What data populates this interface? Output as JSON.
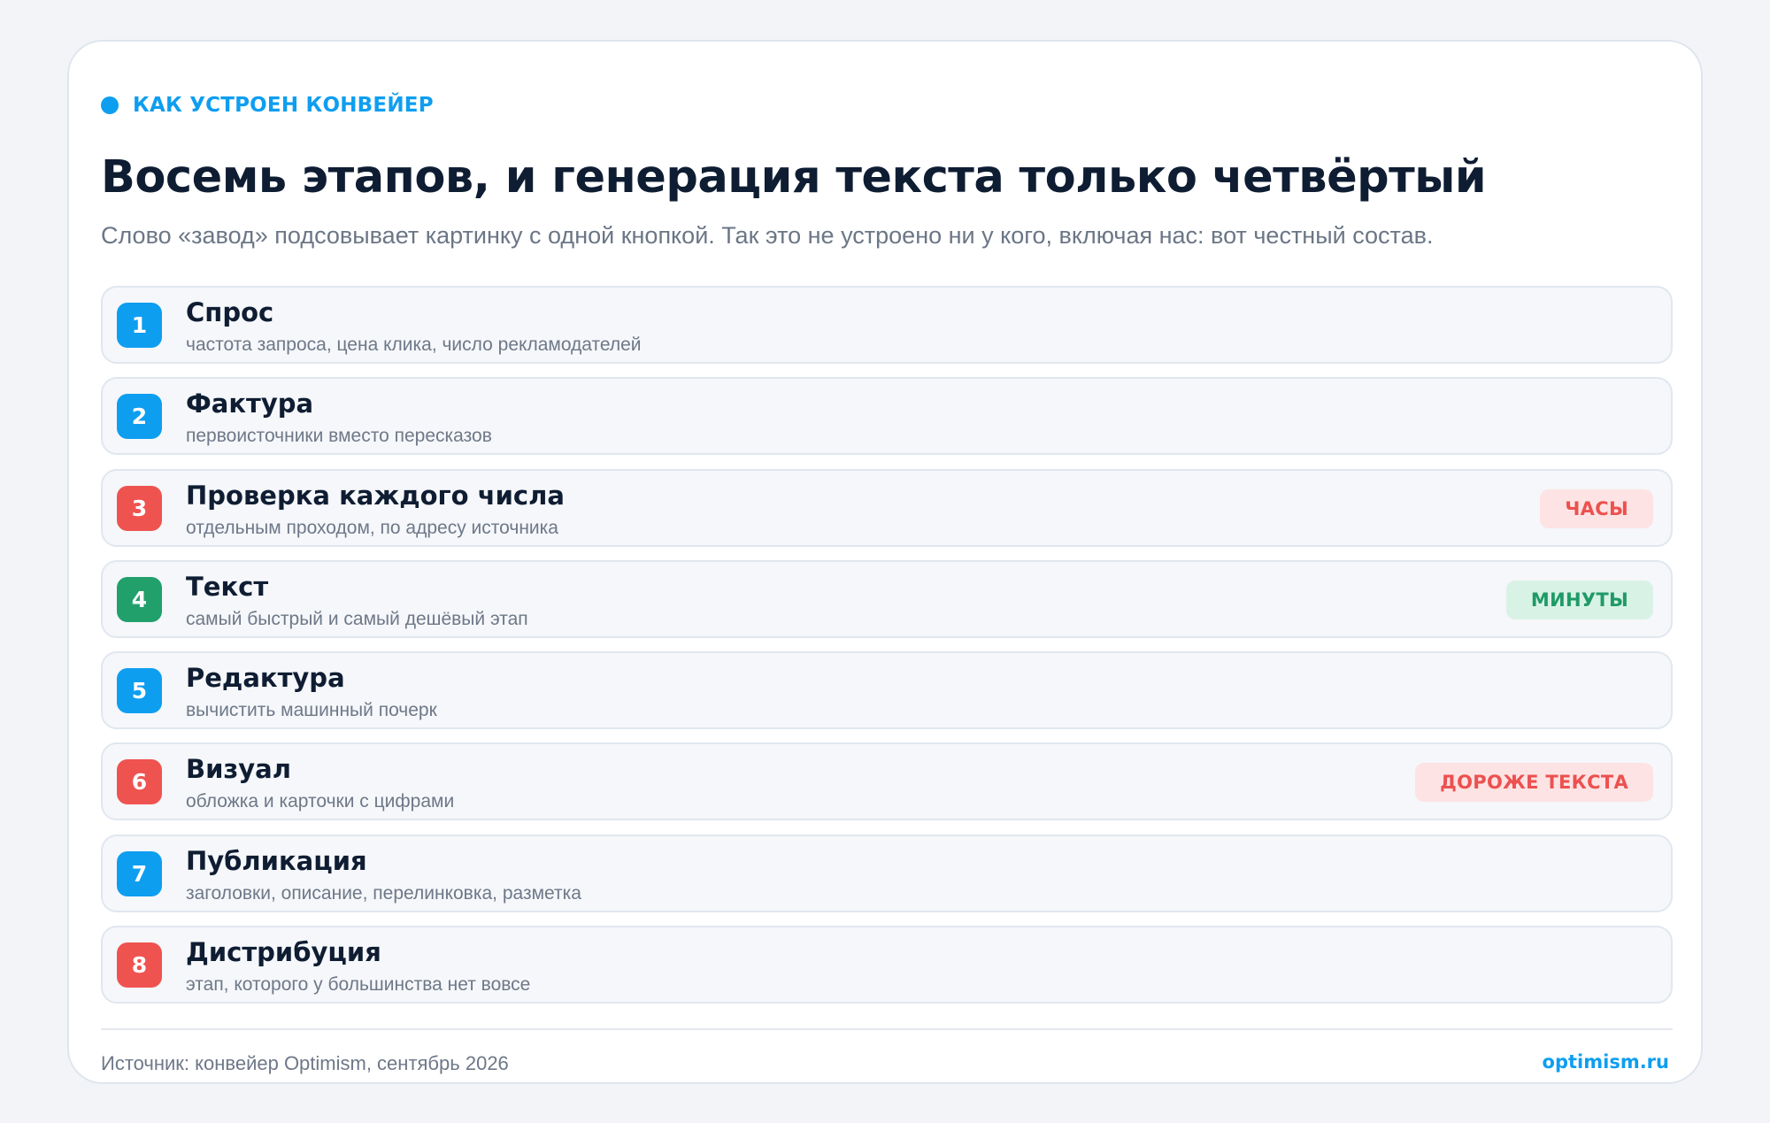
{
  "eyebrow": "КАК УСТРОЕН КОНВЕЙЕР",
  "title": "Восемь этапов, и генерация текста только четвёртый",
  "subtitle": "Слово «завод» подсовывает картинку с одной кнопкой. Так это не устроено ни у кого, включая нас: вот честный состав.",
  "colors": {
    "accent": "#0e9ef0",
    "red": "#ef5350",
    "green": "#21a06c"
  },
  "steps": [
    {
      "num": "1",
      "name": "Спрос",
      "desc": "частота запроса, цена клика, число рекламодателей",
      "color": "blue",
      "badge": ""
    },
    {
      "num": "2",
      "name": "Фактура",
      "desc": "первоисточники вместо пересказов",
      "color": "blue",
      "badge": ""
    },
    {
      "num": "3",
      "name": "Проверка каждого числа",
      "desc": "отдельным проходом, по адресу источника",
      "color": "red",
      "badge": "ЧАСЫ",
      "badge_color": "red"
    },
    {
      "num": "4",
      "name": "Текст",
      "desc": "самый быстрый и самый дешёвый этап",
      "color": "green",
      "badge": "МИНУТЫ",
      "badge_color": "green"
    },
    {
      "num": "5",
      "name": "Редактура",
      "desc": "вычистить машинный почерк",
      "color": "blue",
      "badge": ""
    },
    {
      "num": "6",
      "name": "Визуал",
      "desc": "обложка и карточки с цифрами",
      "color": "red",
      "badge": "ДОРОЖЕ ТЕКСТА",
      "badge_color": "red"
    },
    {
      "num": "7",
      "name": "Публикация",
      "desc": "заголовки, описание, перелинковка, разметка",
      "color": "blue",
      "badge": ""
    },
    {
      "num": "8",
      "name": "Дистрибуция",
      "desc": "этап, которого у большинства нет вовсе",
      "color": "red",
      "badge": ""
    }
  ],
  "footer": {
    "source": "Источник: конвейер Optimism, сентябрь 2026",
    "brand": "optimism.ru"
  }
}
